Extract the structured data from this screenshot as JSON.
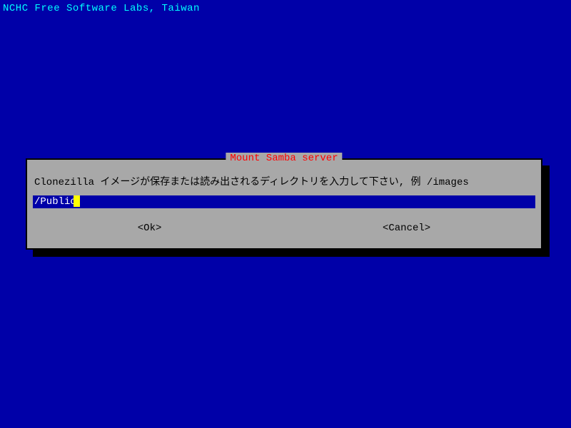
{
  "header": {
    "org": "NCHC Free Software Labs, Taiwan"
  },
  "dialog": {
    "title": "Mount Samba server",
    "prompt": "Clonezilla イメージが保存または読み出されるディレクトリを入力して下さい, 例 /images",
    "input_value": "/Public",
    "ok_label": "<Ok>",
    "cancel_label": "<Cancel>"
  },
  "colors": {
    "background": "#0000a8",
    "dialog_bg": "#a8a8a8",
    "title_fg": "#ff0000",
    "header_fg": "#00ffff",
    "cursor": "#ffff00"
  }
}
